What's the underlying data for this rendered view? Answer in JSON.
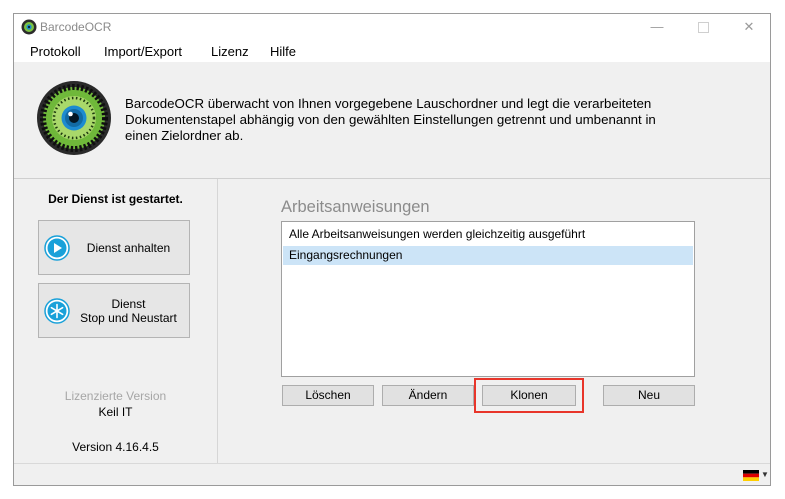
{
  "window": {
    "title": "BarcodeOCR"
  },
  "menu": [
    "Protokoll",
    "Import/Export",
    "Lizenz",
    "Hilfe"
  ],
  "header": {
    "description_lines": [
      "BarcodeOCR überwacht von Ihnen vorgegebene Lauschordner und legt die verarbeiteten",
      "Dokumentenstapel abhängig von den gewählten Einstellungen getrennt und umbenannt in",
      "einen Zielordner ab."
    ]
  },
  "service": {
    "status": "Der Dienst ist gestartet.",
    "stop_label": "Dienst anhalten",
    "restart_label_line1": "Dienst",
    "restart_label_line2": "Stop und Neustart"
  },
  "license": {
    "label": "Lizenzierte Version",
    "licensee": "Keil IT",
    "version": "Version 4.16.4.5"
  },
  "work_instructions": {
    "title": "Arbeitsanweisungen",
    "items": [
      {
        "label": "Alle Arbeitsanweisungen werden gleichzeitig ausgeführt",
        "selected": false
      },
      {
        "label": "Eingangsrechnungen",
        "selected": true
      }
    ]
  },
  "actions": {
    "delete_label": "Löschen",
    "edit_label": "Ändern",
    "clone_label": "Klonen",
    "new_label": "Neu"
  },
  "statusbar": {
    "language_flag": "german-flag-icon"
  },
  "colors": {
    "highlight": "#e8352a",
    "selection": "#cce4f7"
  }
}
